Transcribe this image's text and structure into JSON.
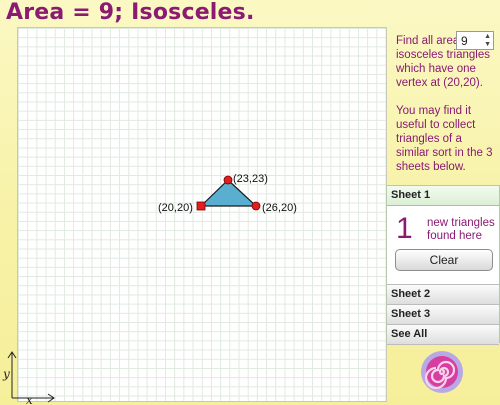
{
  "title": "Area = 9; Isosceles.",
  "instructions": {
    "line1": "Find all area",
    "rest": "isosceles triangles which have one vertex at (20,20).",
    "hint": "You may find it useful to collect triangles of a similar sort in the 3 sheets below."
  },
  "area_stepper": {
    "value": "9"
  },
  "triangle": {
    "fill": "#5aaed0",
    "vertices": [
      {
        "label": "(23,23)",
        "x": 23,
        "y": 23
      },
      {
        "label": "(20,20)",
        "x": 20,
        "y": 20
      },
      {
        "label": "(26,20)",
        "x": 26,
        "y": 20
      }
    ]
  },
  "axes": {
    "x_label": "x",
    "y_label": "y"
  },
  "sheets": [
    {
      "label": "Sheet 1",
      "count": "1",
      "count_label": "new triangles found here",
      "clear_label": "Clear"
    },
    {
      "label": "Sheet 2"
    },
    {
      "label": "Sheet 3"
    },
    {
      "label": "See All"
    }
  ],
  "colors": {
    "accent": "#8a1a72",
    "vertex": "#e02020"
  },
  "icons": {
    "logo": "swirl-lollipop-icon"
  }
}
